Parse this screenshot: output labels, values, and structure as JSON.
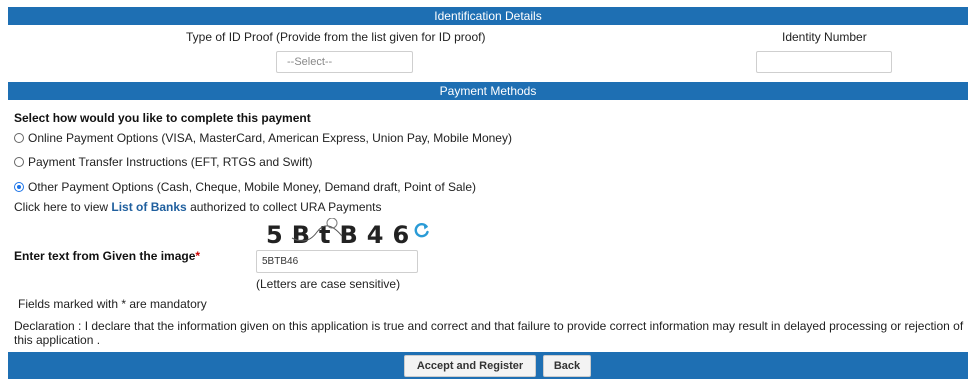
{
  "identification": {
    "header": "Identification Details",
    "id_type_label": "Type of ID Proof (Provide from the list given for ID proof)",
    "id_type_selected": "--Select--",
    "identity_number_label": "Identity Number",
    "identity_number_value": ""
  },
  "payment": {
    "header": "Payment Methods",
    "prompt": "Select how would you like to complete this payment",
    "options": [
      {
        "label": "Online Payment Options (VISA, MasterCard, American Express, Union Pay, Mobile Money)",
        "checked": false
      },
      {
        "label": "Payment Transfer Instructions (EFT, RTGS and Swift)",
        "checked": false
      },
      {
        "label": "Other Payment Options (Cash, Cheque, Mobile Money, Demand draft, Point of Sale)",
        "checked": true
      }
    ],
    "banks_prefix": "Click here to view ",
    "banks_link": "List of Banks",
    "banks_suffix": " authorized to collect URA Payments"
  },
  "captcha": {
    "image_text": "5BtB46",
    "label": "Enter text from Given the image",
    "required_mark": "*",
    "input_value": "5BTB46",
    "hint": "(Letters are case sensitive)"
  },
  "notes": {
    "mandatory": "Fields marked with * are mandatory",
    "declaration": "Declaration : I declare that the information given on this application is true and correct and that failure to provide correct information may result in delayed processing or rejection of this application ."
  },
  "buttons": {
    "accept": "Accept and Register",
    "back": "Back"
  },
  "colors": {
    "header_band": "#1e6fb3",
    "link": "#1f5f9e",
    "required": "#cc0000",
    "radio_selected": "#1a73e8"
  }
}
